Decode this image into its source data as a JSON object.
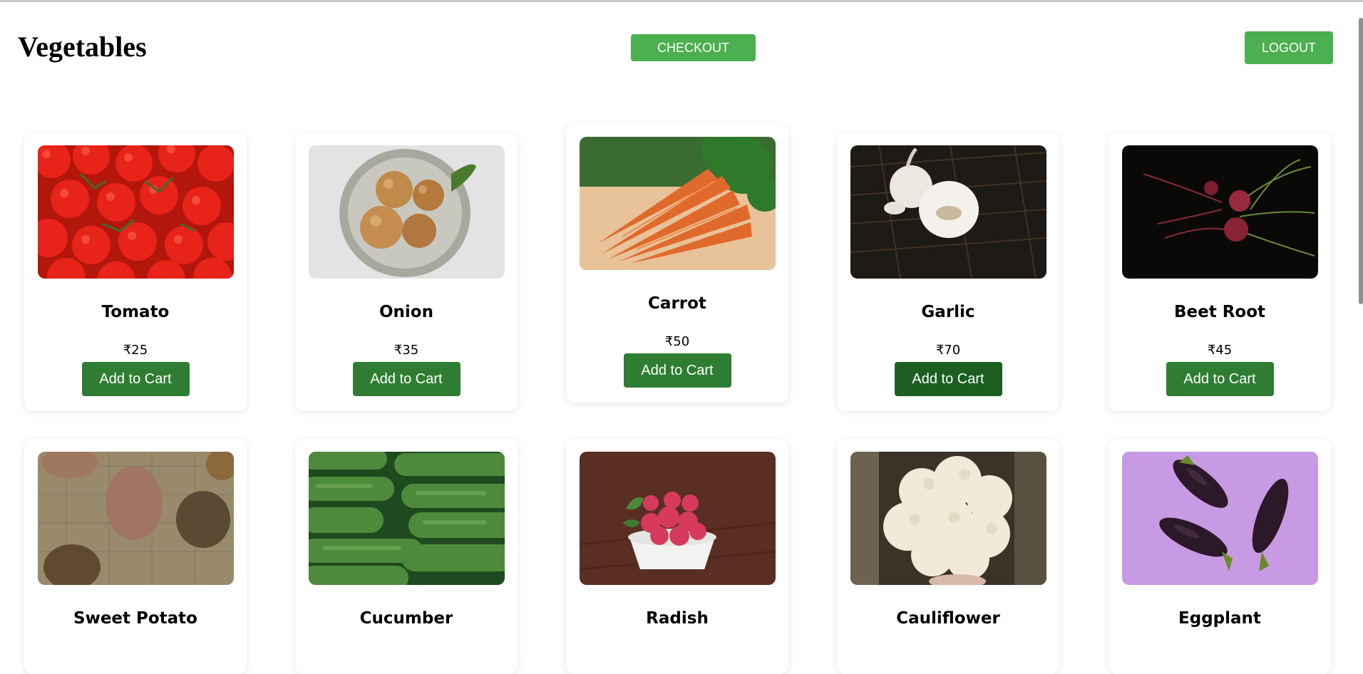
{
  "page": {
    "title": "Vegetables",
    "checkout_label": "CHECKOUT",
    "logout_label": "LOGOUT"
  },
  "colors": {
    "accent": "#4caf50",
    "add_button": "#2e7d32",
    "add_button_hover": "#1b5e20"
  },
  "products": [
    {
      "name": "Tomato",
      "price": "₹25",
      "button": "Add to Cart",
      "image_icon": "tomato-image"
    },
    {
      "name": "Onion",
      "price": "₹35",
      "button": "Add to Cart",
      "image_icon": "onion-image"
    },
    {
      "name": "Carrot",
      "price": "₹50",
      "button": "Add to Cart",
      "image_icon": "carrot-image"
    },
    {
      "name": "Garlic",
      "price": "₹70",
      "button": "Add to Cart",
      "image_icon": "garlic-image"
    },
    {
      "name": "Beet Root",
      "price": "₹45",
      "button": "Add to Cart",
      "image_icon": "beetroot-image"
    },
    {
      "name": "Sweet Potato",
      "image_icon": "sweet-potato-image"
    },
    {
      "name": "Cucumber",
      "image_icon": "cucumber-image"
    },
    {
      "name": "Radish",
      "image_icon": "radish-image"
    },
    {
      "name": "Cauliflower",
      "image_icon": "cauliflower-image"
    },
    {
      "name": "Eggplant",
      "image_icon": "eggplant-image"
    }
  ]
}
